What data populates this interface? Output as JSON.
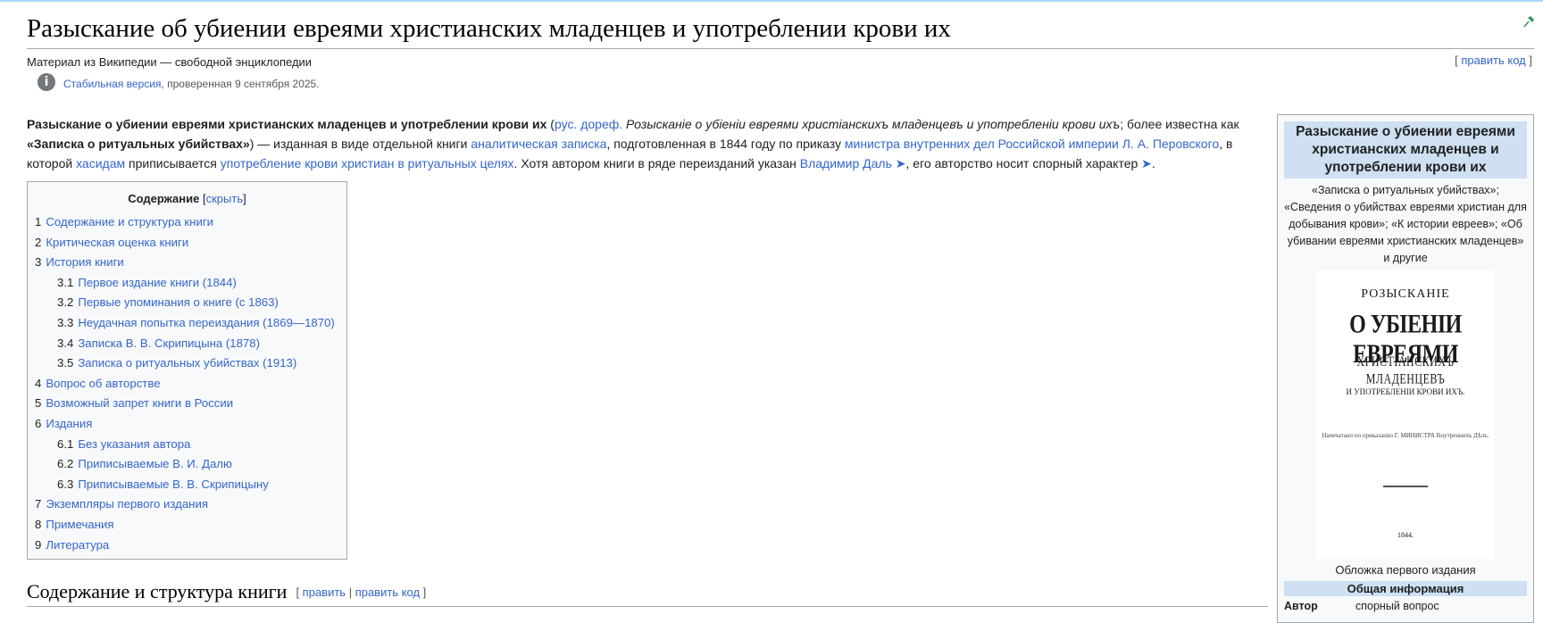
{
  "title": "Разыскание об убиении евреями христианских младенцев и употреблении крови их",
  "site_sub": "Материал из Википедии — свободной энциклопедии",
  "edit_top": "править код",
  "stable": {
    "link": "Стабильная версия",
    "rest": ", проверенная 9 сентября 2025."
  },
  "lead": {
    "b1": "Разыскание о убиении евреями христианских младенцев и употреблении крови их",
    "t1": " (",
    "l1": "рус. дореф.",
    "i1": " Розысканіе о убіеніи евреями христіанскихъ младенцевъ и употребленіи крови ихъ",
    "t2": "; более известна как ",
    "b2": "«Записка о ритуальных убийствах»",
    "t3": ") — изданная в виде отдельной книги ",
    "l2": "аналитическая записка",
    "t4": ", подготовленная в 1844 году по приказу ",
    "l3": "министра внутренних дел Российской империи",
    "t5": " ",
    "l4": "Л. А. Перовского",
    "t6": ", в которой ",
    "l5": "хасидам",
    "t7": " приписывается ",
    "l6": "употребление крови христиан в ритуальных целях",
    "t8": ". Хотя автором книги в ряде переизданий указан ",
    "l7": "Владимир Даль",
    "arrow": " ➤",
    "t9": ", его авторство носит спорный характер",
    "arrow2": " ➤",
    "t10": "."
  },
  "toc": {
    "title": "Содержание",
    "toggle": "скрыть",
    "items": [
      {
        "num": "1",
        "label": "Содержание и структура книги"
      },
      {
        "num": "2",
        "label": "Критическая оценка книги"
      },
      {
        "num": "3",
        "label": "История книги"
      },
      {
        "num": "3.1",
        "label": "Первое издание книги (1844)"
      },
      {
        "num": "3.2",
        "label": "Первые упоминания о книге (с 1863)"
      },
      {
        "num": "3.3",
        "label": "Неудачная попытка переиздания (1869—1870)"
      },
      {
        "num": "3.4",
        "label": "Записка В. В. Скрипицына (1878)"
      },
      {
        "num": "3.5",
        "label": "Записка о ритуальных убийствах (1913)"
      },
      {
        "num": "4",
        "label": "Вопрос об авторстве"
      },
      {
        "num": "5",
        "label": "Возможный запрет книги в России"
      },
      {
        "num": "6",
        "label": "Издания"
      },
      {
        "num": "6.1",
        "label": "Без указания автора"
      },
      {
        "num": "6.2",
        "label": "Приписываемые В. И. Далю"
      },
      {
        "num": "6.3",
        "label": "Приписываемые В. В. Скрипицыну"
      },
      {
        "num": "7",
        "label": "Экземпляры первого издания"
      },
      {
        "num": "8",
        "label": "Примечания"
      },
      {
        "num": "9",
        "label": "Литература"
      }
    ]
  },
  "section": {
    "title": "Содержание и структура книги",
    "edit": "править",
    "edit_code": "править код"
  },
  "infobox": {
    "title": "Разыскание о убиении евреями христианских младенцев и употреблении крови их",
    "alt_names": "«Записка о ритуальных убийствах»; «Сведения о убийствах евреями христиан для добывания крови»; «К истории евреев»; «Об убивании евреями христианских младенцев» и другие",
    "cover": {
      "line1": "РОЗЫСКАНІЕ",
      "line2": "О УБІЕНІИ ЕВРЕЯМИ",
      "line3": "ХРИСТІАНСКИХЪ МЛАДЕНЦЕВЪ",
      "line4": "И УПОТРЕБЛЕНІИ КРОВИ ИХЪ.",
      "line5": "Напечатано по приказанію Г. МИНИСТРА Внутреннихъ Дѣлъ.",
      "year": "1844."
    },
    "caption": "Обложка первого издания",
    "section": "Общая информация",
    "author_key": "Автор",
    "author_val": "спорный вопрос"
  }
}
